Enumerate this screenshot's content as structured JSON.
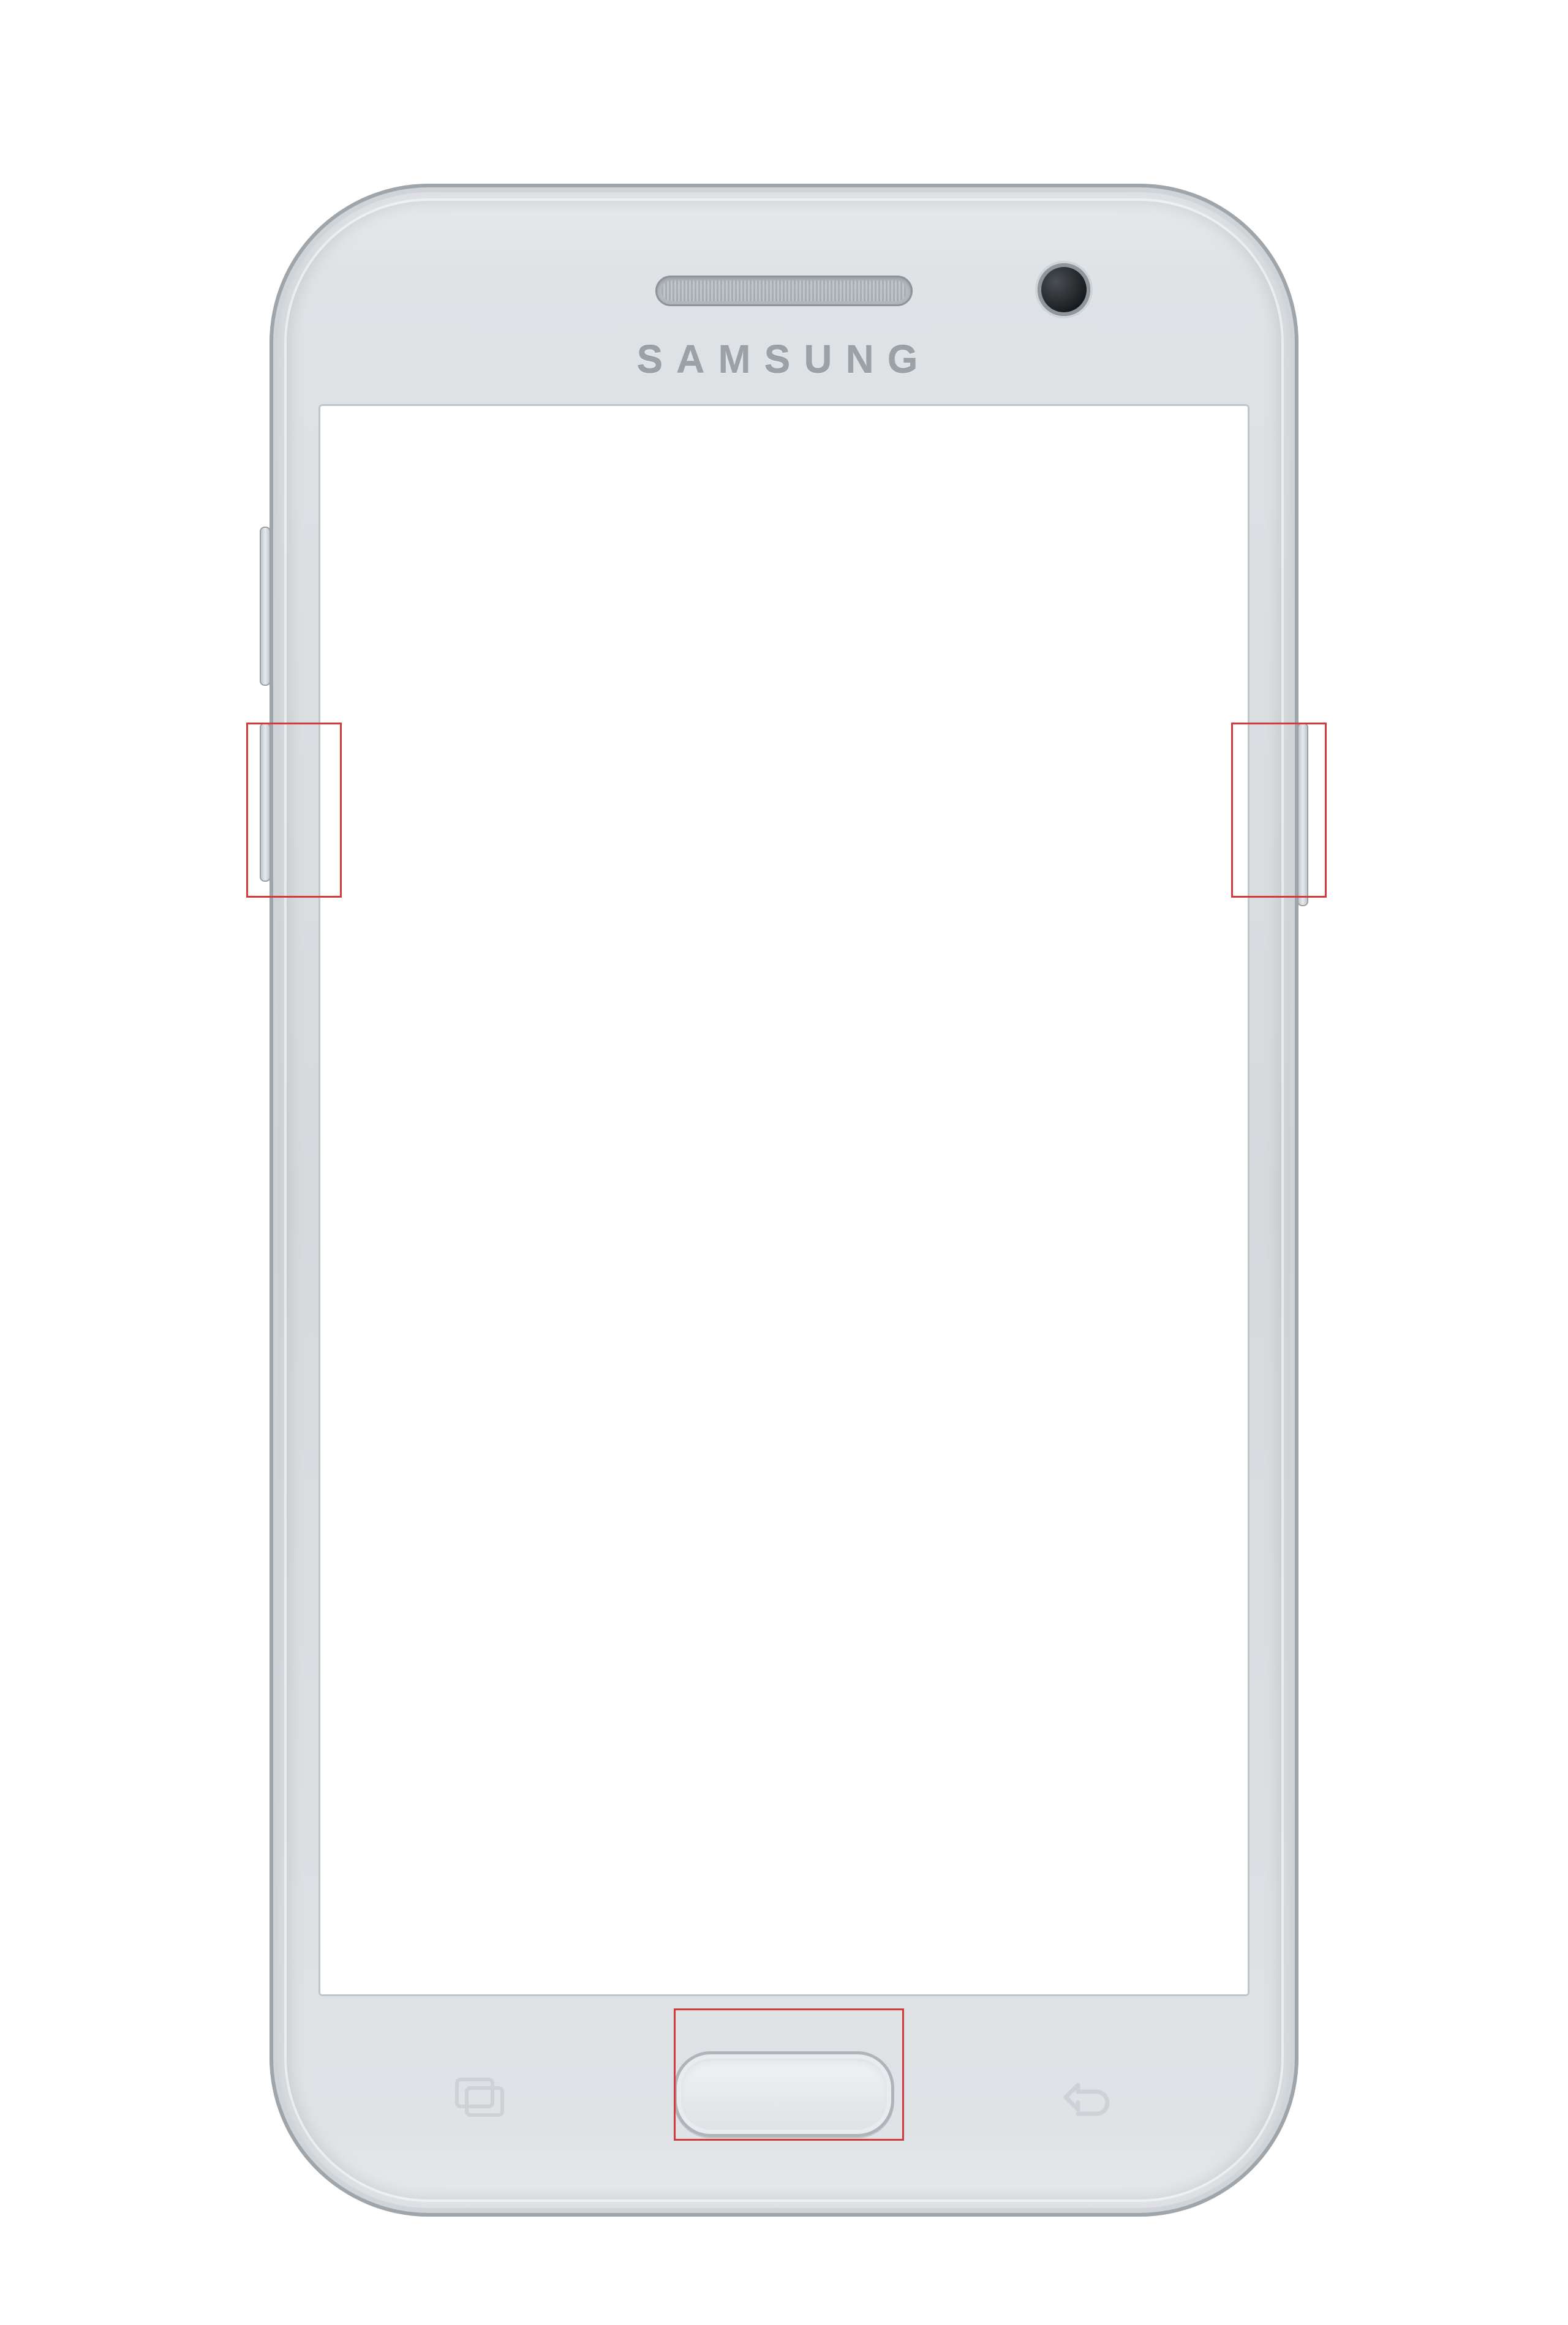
{
  "brand_text": "SAMSUNG",
  "callouts": {
    "left": "volume-down highlight",
    "right": "power-button highlight",
    "home": "home-button highlight"
  },
  "buttons": {
    "volume_up": "Volume Up",
    "volume_down": "Volume Down",
    "power": "Power",
    "home": "Home",
    "recents": "Recents",
    "back": "Back"
  },
  "colors": {
    "callout_border": "#d23b3b",
    "frame_silver": "#d6dadd"
  }
}
